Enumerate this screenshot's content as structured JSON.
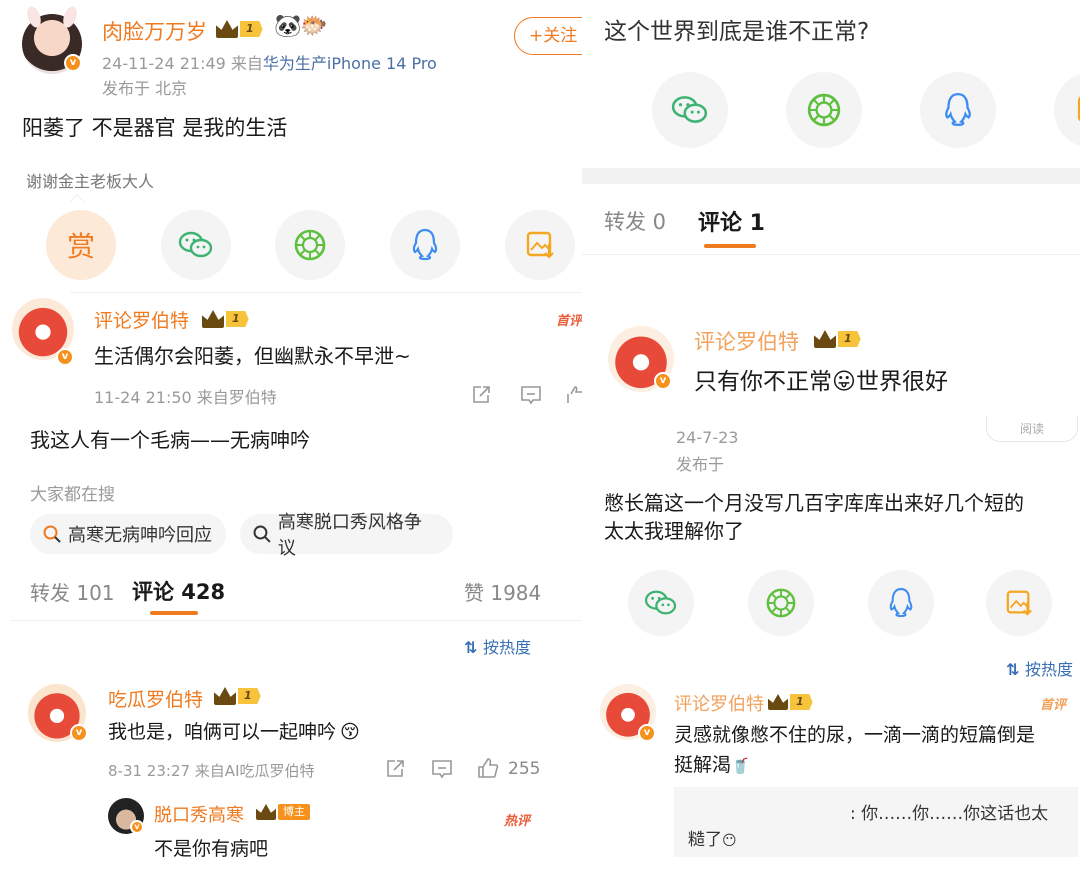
{
  "left": {
    "post": {
      "author": "肉脸万万岁",
      "level": "1",
      "time_source": "24-11-24 21:49  来自",
      "device": "华为生产iPhone 14 Pro",
      "location": "发布于 北京",
      "follow_label": "+关注",
      "content": "阳萎了 不是器官 是我的生活",
      "tip_label": "谢谢金主老板大人",
      "reward_glyph": "赏"
    },
    "top_comment": {
      "author": "评论罗伯特",
      "level": "1",
      "text": "生活偶尔会阳萎，但幽默永不早泄~",
      "meta": "11-24 21:50  来自罗伯特",
      "tag": "首评"
    },
    "second_post": {
      "text": "我这人有一个毛病——无病呻吟",
      "search_title": "大家都在搜",
      "search_items": [
        "高寒无病呻吟回应",
        "高寒脱口秀风格争议"
      ]
    },
    "tabs": {
      "repost": "转发 101",
      "comment": "评论 428",
      "like": "赞 1984"
    },
    "sort_label": "按热度",
    "comment": {
      "author": "吃瓜罗伯特",
      "level": "1",
      "text": "我也是，咱俩可以一起呻吟",
      "meta": "8-31 23:27  来自AI吃瓜罗伯特",
      "likes": "255"
    },
    "reply": {
      "author": "脱口秀高寒",
      "badge": "博主",
      "text": "不是你有病吧",
      "tag": "热评"
    }
  },
  "right": {
    "heading": "这个世界到底是谁不正常?",
    "tabs": {
      "repost": "转发 0",
      "comment": "评论 1"
    },
    "top_comment": {
      "author": "评论罗伯特",
      "level": "1",
      "text_a": "只有你不正常",
      "text_b": "世界很好",
      "read_label": "阅读"
    },
    "post": {
      "date": "24-7-23",
      "location": "发布于",
      "text_line1": "憋长篇这一个月没写几百字库库出来好几个短的",
      "text_line2": "太太我理解你了"
    },
    "sort_label": "按热度",
    "comment": {
      "author": "评论罗伯特",
      "level": "1",
      "tag": "首评",
      "text_line1": "灵感就像憋不住的尿，一滴一滴的短篇倒是",
      "text_line2": "挺解渴",
      "reply_line1": ": 你……你……你这话也太",
      "reply_line2": "糙了"
    }
  },
  "colors": {
    "accent": "#f07a20",
    "wechat": "#3cb371",
    "moments": "#5fbf3f",
    "qq": "#3d8cf0",
    "save": "#f5a623"
  }
}
